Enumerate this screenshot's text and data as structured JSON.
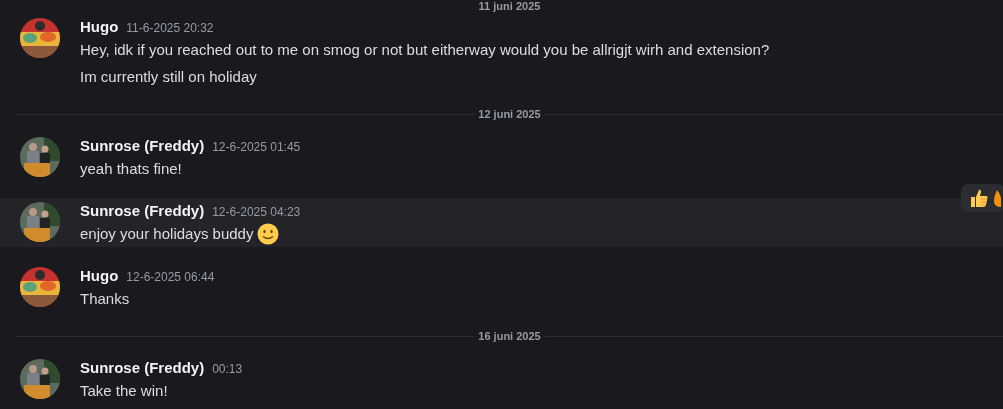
{
  "feed": [
    {
      "kind": "divider",
      "label": "11 juni 2025"
    },
    {
      "kind": "message",
      "author": "Hugo",
      "timestamp": "11-6-2025 20:32",
      "hovered": false,
      "emoji": false,
      "lines": [
        "Hey, idk if you reached out to me on smog or not but eitherway would you be allrigjt wirh and extension?",
        "Im currently still on holiday"
      ]
    },
    {
      "kind": "divider",
      "label": "12 juni 2025"
    },
    {
      "kind": "message",
      "author": "Sunrose (Freddy)",
      "timestamp": "12-6-2025 01:45",
      "hovered": false,
      "emoji": false,
      "lines": [
        "yeah thats fine!"
      ]
    },
    {
      "kind": "message",
      "author": "Sunrose (Freddy)",
      "timestamp": "12-6-2025 04:23",
      "hovered": true,
      "emoji": true,
      "lines": [
        "enjoy your holidays buddy"
      ]
    },
    {
      "kind": "message",
      "author": "Hugo",
      "timestamp": "12-6-2025 06:44",
      "hovered": false,
      "emoji": false,
      "lines": [
        "Thanks"
      ]
    },
    {
      "kind": "divider",
      "label": "16 juni 2025"
    },
    {
      "kind": "message",
      "author": "Sunrose (Freddy)",
      "timestamp": "00:13",
      "hovered": false,
      "emoji": false,
      "lines": [
        "Take the win!"
      ]
    }
  ]
}
